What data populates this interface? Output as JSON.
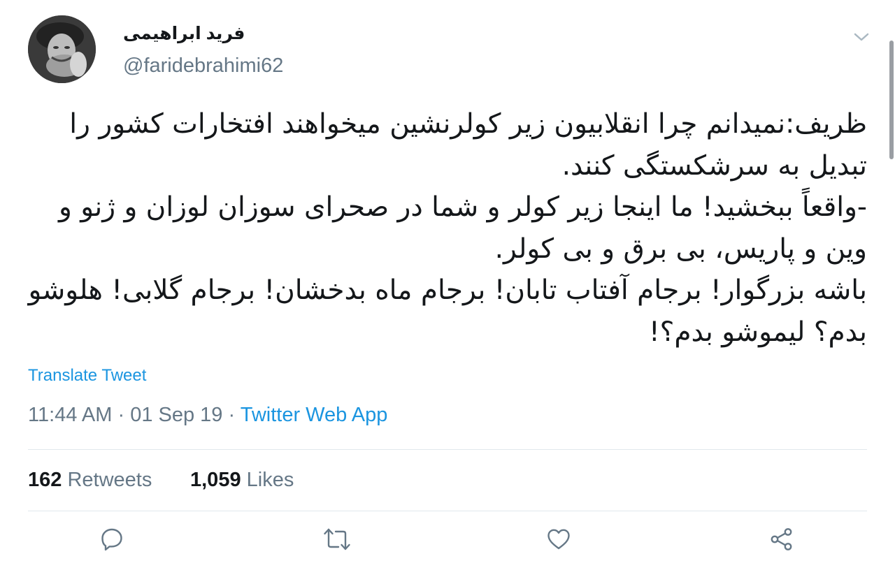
{
  "author": {
    "display_name": "فرید ابراهیمی",
    "handle": "@faridebrahimi62"
  },
  "tweet": {
    "lines": [
      "ظریف:نمیدانم چرا انقلابیون زیر کولرنشین میخواهند افتخارات کشور را",
      "تبدیل به سرشکستگی کنند.",
      "-واقعاً ببخشید! ما اینجا زیر کولر و شما در صحرای سوزان لوزان و ژنو و",
      "وین و پاریس، بی برق و بی کولر.",
      "باشه بزرگوار! برجام آفتاب تابان! برجام ماه بدخشان! برجام گلابی! هلوشو",
      "بدم؟ لیموشو بدم؟!"
    ],
    "translate_label": "Translate Tweet",
    "time": "11:44 AM",
    "date": "01 Sep 19",
    "separator": "·",
    "source": "Twitter Web App"
  },
  "stats": {
    "retweets_count": "162",
    "retweets_label": "Retweets",
    "likes_count": "1,059",
    "likes_label": "Likes"
  },
  "icons": {
    "avatar": "avatar-photo",
    "caret": "chevron-down-icon",
    "reply": "reply-icon",
    "retweet": "retweet-icon",
    "like": "heart-icon",
    "share": "share-icon"
  },
  "colors": {
    "text": "#14171a",
    "secondary": "#657786",
    "link": "#1b95e0",
    "divider": "#e1e8ed"
  }
}
